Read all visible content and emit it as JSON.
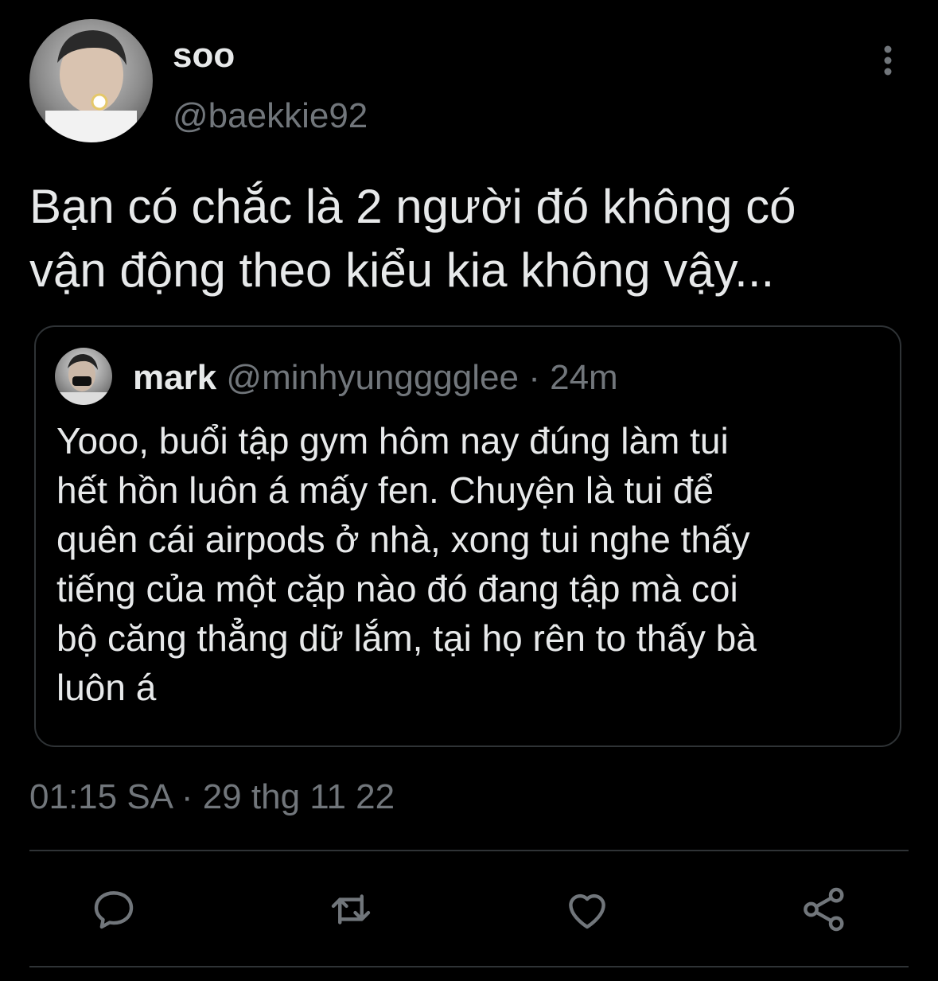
{
  "author": {
    "display_name": "soo",
    "handle": "@baekkie92"
  },
  "tweet": {
    "text": "Bạn có chắc là 2 người đó không có\nvận động theo kiểu kia không vậy...",
    "timestamp": "01:15 SA · 29 thg 11 22"
  },
  "quoted_tweet": {
    "display_name": "mark",
    "handle": "@minhyungggglee",
    "time_ago": "· 24m",
    "text": "Yooo, buổi tập gym hôm nay đúng làm tui\nhết hồn luôn á mấy fen. Chuyện là tui để\nquên cái airpods ở nhà, xong tui nghe thấy\ntiếng của một cặp nào đó đang tập mà coi\nbộ căng thẳng dữ lắm, tại họ rên to thấy bà\nluôn á"
  },
  "actions": {
    "icons": [
      "reply-icon",
      "retweet-icon",
      "like-icon",
      "share-icon"
    ]
  },
  "colors": {
    "background": "#000000",
    "text_primary": "#e7e9ea",
    "text_secondary": "#71767b",
    "border": "#2f3336"
  }
}
